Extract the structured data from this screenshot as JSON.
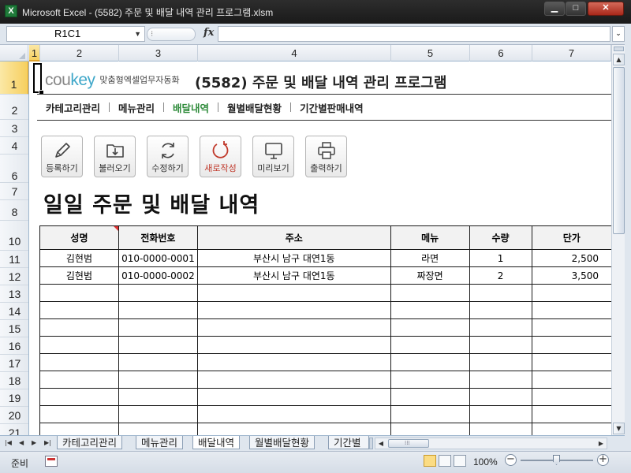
{
  "window": {
    "app_icon": "X",
    "title": "Microsoft Excel - (5582) 주문 및 배달 내역 관리 프로그램.xlsm",
    "minimize": "▁",
    "maximize": "□",
    "close": "✕"
  },
  "formula_bar": {
    "name_box": "R1C1",
    "fx": "fx",
    "value": ""
  },
  "columns": [
    "1",
    "2",
    "3",
    "4",
    "5",
    "6",
    "7"
  ],
  "rows": [
    "1",
    "2",
    "3",
    "4",
    "6",
    "7",
    "8",
    "10",
    "11",
    "12",
    "13",
    "14",
    "15",
    "16",
    "17",
    "18",
    "19",
    "20",
    "21"
  ],
  "header": {
    "logo_primary": "cou",
    "logo_accent": "key",
    "logo_tagline": "맞춤형엑셀업무자동화",
    "title": "(5582) 주문 및 배달 내역 관리 프로그램"
  },
  "nav": [
    {
      "label": "카테고리관리",
      "active": false
    },
    {
      "label": "메뉴관리",
      "active": false
    },
    {
      "label": "배달내역",
      "active": true
    },
    {
      "label": "월별배달현황",
      "active": false
    },
    {
      "label": "기간별판매내역",
      "active": false
    }
  ],
  "toolbar": [
    {
      "label": "등록하기",
      "icon": "pencil-icon"
    },
    {
      "label": "불러오기",
      "icon": "folder-download-icon"
    },
    {
      "label": "수정하기",
      "icon": "refresh-icon"
    },
    {
      "label": "새로작성",
      "icon": "new-circle-icon"
    },
    {
      "label": "미리보기",
      "icon": "monitor-icon"
    },
    {
      "label": "출력하기",
      "icon": "printer-icon"
    }
  ],
  "section_title": "일일 주문 및 배달 내역",
  "table": {
    "headers": [
      "성명",
      "전화번호",
      "주소",
      "메뉴",
      "수량",
      "단가"
    ],
    "rows": [
      [
        "김현범",
        "010-0000-0001",
        "부산시 남구 대연1동",
        "라면",
        "1",
        "2,500"
      ],
      [
        "김현범",
        "010-0000-0002",
        "부산시 남구 대연1동",
        "짜장면",
        "2",
        "3,500"
      ],
      [
        "",
        "",
        "",
        "",
        "",
        ""
      ],
      [
        "",
        "",
        "",
        "",
        "",
        ""
      ],
      [
        "",
        "",
        "",
        "",
        "",
        ""
      ],
      [
        "",
        "",
        "",
        "",
        "",
        ""
      ],
      [
        "",
        "",
        "",
        "",
        "",
        ""
      ],
      [
        "",
        "",
        "",
        "",
        "",
        ""
      ],
      [
        "",
        "",
        "",
        "",
        "",
        ""
      ],
      [
        "",
        "",
        "",
        "",
        "",
        ""
      ],
      [
        "",
        "",
        "",
        "",
        "",
        ""
      ]
    ]
  },
  "sheet_tabs": [
    {
      "label": "카테고리관리",
      "active": false
    },
    {
      "label": "메뉴관리",
      "active": false
    },
    {
      "label": "배달내역",
      "active": true
    },
    {
      "label": "월별배달현황",
      "active": false
    },
    {
      "label": "기간별",
      "active": false
    }
  ],
  "status": {
    "ready": "준비",
    "zoom": "100%",
    "zoom_minus": "−",
    "zoom_plus": "+"
  },
  "colors": {
    "accent_green": "#2e8b3a",
    "new_red": "#c0392b",
    "logo_blue": "#3fa7c9",
    "selection_gold": "#f6cf5e"
  }
}
